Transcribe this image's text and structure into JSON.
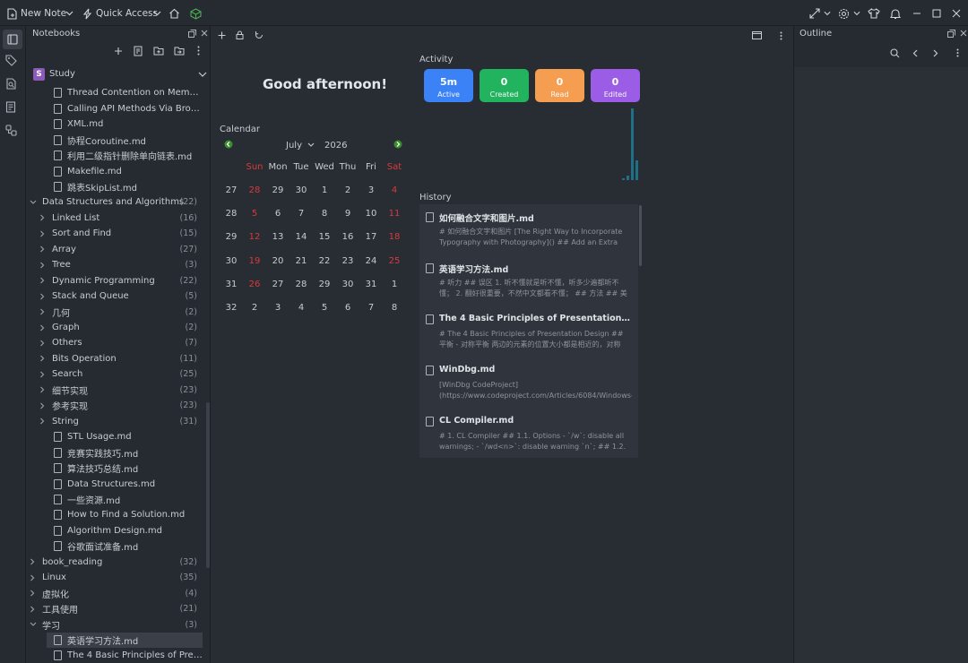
{
  "toolbar": {
    "new_note": "New Note",
    "quick_access": "Quick Access"
  },
  "notebooks": {
    "title": "Notebooks",
    "current": "Study",
    "current_badge": "S",
    "items": [
      {
        "type": "file",
        "level": 2,
        "label": "Thread Contention on Memory...",
        "count": ""
      },
      {
        "type": "file",
        "level": 2,
        "label": "Calling API Methods Via Browse...",
        "count": ""
      },
      {
        "type": "file",
        "level": 2,
        "label": "XML.md",
        "count": ""
      },
      {
        "type": "file",
        "level": 2,
        "label": "协程Coroutine.md",
        "count": ""
      },
      {
        "type": "file",
        "level": 2,
        "label": "利用二级指针删除单向链表.md",
        "count": ""
      },
      {
        "type": "file",
        "level": 2,
        "label": "Makefile.md",
        "count": ""
      },
      {
        "type": "file",
        "level": 2,
        "label": "跳表SkipList.md",
        "count": ""
      },
      {
        "type": "folder-open",
        "level": 0,
        "label": "Data Structures and Algorithms",
        "count": "(22)"
      },
      {
        "type": "folder",
        "level": 1,
        "label": "Linked List",
        "count": "(16)"
      },
      {
        "type": "folder",
        "level": 1,
        "label": "Sort and Find",
        "count": "(15)"
      },
      {
        "type": "folder",
        "level": 1,
        "label": "Array",
        "count": "(27)"
      },
      {
        "type": "folder",
        "level": 1,
        "label": "Tree",
        "count": "(3)"
      },
      {
        "type": "folder",
        "level": 1,
        "label": "Dynamic Programming",
        "count": "(22)"
      },
      {
        "type": "folder",
        "level": 1,
        "label": "Stack and Queue",
        "count": "(5)"
      },
      {
        "type": "folder",
        "level": 1,
        "label": "几何",
        "count": "(2)"
      },
      {
        "type": "folder",
        "level": 1,
        "label": "Graph",
        "count": "(2)"
      },
      {
        "type": "folder",
        "level": 1,
        "label": "Others",
        "count": "(7)"
      },
      {
        "type": "folder",
        "level": 1,
        "label": "Bits Operation",
        "count": "(11)"
      },
      {
        "type": "folder",
        "level": 1,
        "label": "Search",
        "count": "(25)"
      },
      {
        "type": "folder",
        "level": 1,
        "label": "细节实现",
        "count": "(23)"
      },
      {
        "type": "folder",
        "level": 1,
        "label": "参考实现",
        "count": "(23)"
      },
      {
        "type": "folder",
        "level": 1,
        "label": "String",
        "count": "(31)"
      },
      {
        "type": "file",
        "level": 2,
        "label": "STL Usage.md",
        "count": ""
      },
      {
        "type": "file",
        "level": 2,
        "label": "竞赛实践技巧.md",
        "count": ""
      },
      {
        "type": "file",
        "level": 2,
        "label": "算法技巧总结.md",
        "count": ""
      },
      {
        "type": "file",
        "level": 2,
        "label": "Data Structures.md",
        "count": ""
      },
      {
        "type": "file",
        "level": 2,
        "label": "一些资源.md",
        "count": ""
      },
      {
        "type": "file",
        "level": 2,
        "label": "How to Find a Solution.md",
        "count": ""
      },
      {
        "type": "file",
        "level": 2,
        "label": "Algorithm Design.md",
        "count": ""
      },
      {
        "type": "file",
        "level": 2,
        "label": "谷歌面试准备.md",
        "count": ""
      },
      {
        "type": "folder",
        "level": 0,
        "label": "book_reading",
        "count": "(32)"
      },
      {
        "type": "folder",
        "level": 0,
        "label": "Linux",
        "count": "(35)"
      },
      {
        "type": "folder",
        "level": 0,
        "label": "虚拟化",
        "count": "(4)"
      },
      {
        "type": "folder",
        "level": 0,
        "label": "工具使用",
        "count": "(21)"
      },
      {
        "type": "folder-open",
        "level": 0,
        "label": "学习",
        "count": "(3)"
      },
      {
        "type": "file",
        "level": 2,
        "label": "英语学习方法.md",
        "count": "",
        "selected": true
      },
      {
        "type": "file",
        "level": 2,
        "label": "The 4 Basic Principles of Present...",
        "count": ""
      }
    ]
  },
  "main": {
    "greeting": "Good afternoon!",
    "calendar_label": "Calendar",
    "month": "July",
    "year": "2026",
    "weekdays": [
      "Sun",
      "Mon",
      "Tue",
      "Wed",
      "Thu",
      "Fri",
      "Sat"
    ],
    "weeks": [
      {
        "num": "27",
        "days": [
          "28",
          "29",
          "30",
          "1",
          "2",
          "3",
          "4"
        ]
      },
      {
        "num": "28",
        "days": [
          "5",
          "6",
          "7",
          "8",
          "9",
          "10",
          "11"
        ]
      },
      {
        "num": "29",
        "days": [
          "12",
          "13",
          "14",
          "15",
          "16",
          "17",
          "18"
        ]
      },
      {
        "num": "30",
        "days": [
          "19",
          "20",
          "21",
          "22",
          "23",
          "24",
          "25"
        ]
      },
      {
        "num": "31",
        "days": [
          "26",
          "27",
          "28",
          "29",
          "30",
          "31",
          "1"
        ]
      },
      {
        "num": "32",
        "days": [
          "2",
          "3",
          "4",
          "5",
          "6",
          "7",
          "8"
        ]
      }
    ],
    "activity_label": "Activity",
    "activity": [
      {
        "value": "5m",
        "label": "Active",
        "color": "#3b82f6"
      },
      {
        "value": "0",
        "label": "Created",
        "color": "#22b35e"
      },
      {
        "value": "0",
        "label": "Read",
        "color": "#f59e52"
      },
      {
        "value": "0",
        "label": "Edited",
        "color": "#9b5de5"
      }
    ],
    "activity_bars": [
      0.03,
      0.06,
      1.0,
      0.28
    ],
    "history_label": "History",
    "history": [
      {
        "title": "如何融合文字和图片.md",
        "desc": "# 如何融合文字和图片 [The Right Way to Incorporate Typography with Photography]() ## Add an Extra Layer ..."
      },
      {
        "title": "英语学习方法.md",
        "desc": "# 听力 ## 误区 1. 听不懂就是听不懂，听多少遍都听不懂； 2. 翻好很重要，不然中文都看不懂； ## 方法 ## 美剧练听..."
      },
      {
        "title": "The 4 Basic Principles of Presentation Design....",
        "desc": "# The 4 Basic Principles of Presentation Design ## 平衡 - 对称平衡 两边的元素的位置大小都是相近的，对称的。 - ..."
      },
      {
        "title": "WinDbg.md",
        "desc": "[WinDbg CodeProject](https://www.codeproject.com/Articles/6084/Windows-Debuggers-Part-A-WinDbg-Tut..."
      },
      {
        "title": "CL Compiler.md",
        "desc": "# 1. CL Compiler ## 1.1. Options - `/w`: disable all warnings; - `/wd<n>`: disable warning `n`; ## 1.2. Preproces..."
      }
    ]
  },
  "outline": {
    "title": "Outline"
  }
}
